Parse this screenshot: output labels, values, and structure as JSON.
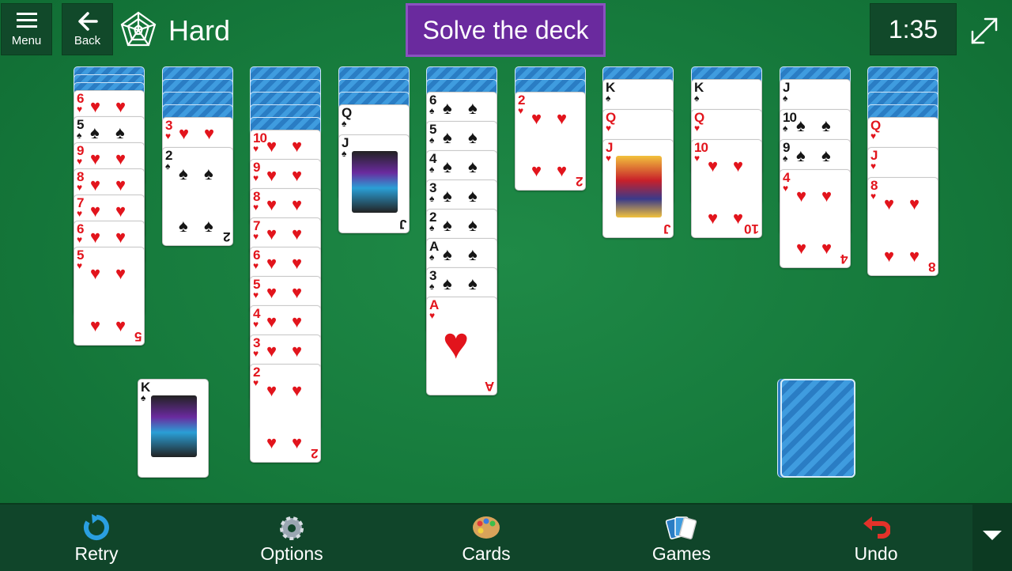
{
  "header": {
    "menu_label": "Menu",
    "back_label": "Back",
    "difficulty": "Hard",
    "goal": "Solve the deck",
    "timer": "1:35"
  },
  "colors": {
    "felt": "#167a3c",
    "goal_bg": "#6a2a9e",
    "bar_bg": "#10452a",
    "red_suit": "#e2141c"
  },
  "tableau": [
    {
      "facedown": 3,
      "cards": [
        [
          "6",
          "♥"
        ],
        [
          "5",
          "♠"
        ],
        [
          "9",
          "♥"
        ],
        [
          "8",
          "♥"
        ],
        [
          "7",
          "♥"
        ],
        [
          "6",
          "♥"
        ],
        [
          "5",
          "♥"
        ]
      ]
    },
    {
      "facedown": 4,
      "cards": [
        [
          "3",
          "♥"
        ],
        [
          "2",
          "♠"
        ]
      ]
    },
    {
      "facedown": 5,
      "cards": [
        [
          "10",
          "♥"
        ],
        [
          "9",
          "♥"
        ],
        [
          "8",
          "♥"
        ],
        [
          "7",
          "♥"
        ],
        [
          "6",
          "♥"
        ],
        [
          "5",
          "♥"
        ],
        [
          "4",
          "♥"
        ],
        [
          "3",
          "♥"
        ],
        [
          "2",
          "♥"
        ]
      ]
    },
    {
      "facedown": 3,
      "cards": [
        [
          "Q",
          "♠"
        ],
        [
          "J",
          "♠"
        ]
      ]
    },
    {
      "facedown": 2,
      "cards": [
        [
          "6",
          "♠"
        ],
        [
          "5",
          "♠"
        ],
        [
          "4",
          "♠"
        ],
        [
          "3",
          "♠"
        ],
        [
          "2",
          "♠"
        ],
        [
          "A",
          "♠"
        ],
        [
          "3",
          "♠"
        ],
        [
          "A",
          "♥"
        ]
      ]
    },
    {
      "facedown": 2,
      "cards": [
        [
          "2",
          "♥"
        ]
      ]
    },
    {
      "facedown": 1,
      "cards": [
        [
          "K",
          "♠"
        ],
        [
          "Q",
          "♥"
        ],
        [
          "J",
          "♥"
        ]
      ]
    },
    {
      "facedown": 1,
      "cards": [
        [
          "K",
          "♠"
        ],
        [
          "Q",
          "♥"
        ],
        [
          "10",
          "♥"
        ]
      ]
    },
    {
      "facedown": 1,
      "cards": [
        [
          "J",
          "♠"
        ],
        [
          "10",
          "♠"
        ],
        [
          "9",
          "♠"
        ],
        [
          "4",
          "♥"
        ]
      ]
    },
    {
      "facedown": 4,
      "cards": [
        [
          "Q",
          "♥"
        ],
        [
          "J",
          "♥"
        ],
        [
          "8",
          "♥"
        ]
      ]
    }
  ],
  "completed_sequence": {
    "rank": "K",
    "suit": "♠"
  },
  "stock": {
    "icon": "card-back"
  },
  "toolbar": [
    {
      "label": "Retry",
      "icon": "retry-icon"
    },
    {
      "label": "Options",
      "icon": "gear-icon"
    },
    {
      "label": "Cards",
      "icon": "palette-icon"
    },
    {
      "label": "Games",
      "icon": "cards-fan-icon"
    },
    {
      "label": "Undo",
      "icon": "undo-icon"
    }
  ]
}
